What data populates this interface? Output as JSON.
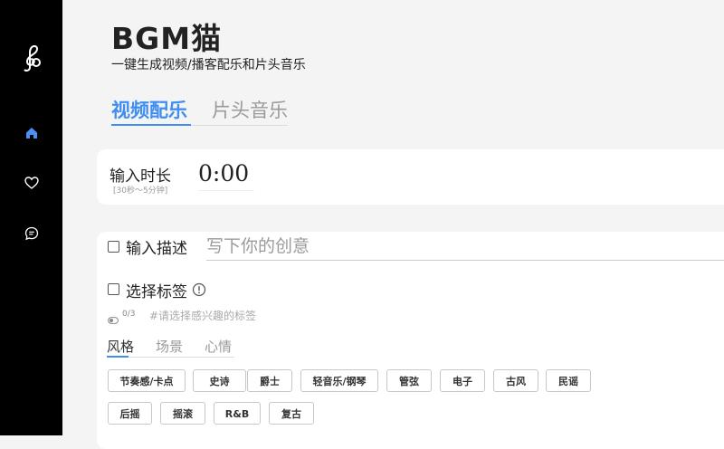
{
  "brand": {
    "title": "BGM猫",
    "subtitle": "一键生成视频/播客配乐和片头音乐"
  },
  "main_tabs": [
    {
      "label": "视频配乐",
      "active": true
    },
    {
      "label": "片头音乐",
      "active": false
    }
  ],
  "duration": {
    "label": "输入时长",
    "hint": "[30秒～5分钟]",
    "value": "0:00"
  },
  "description": {
    "label": "输入描述",
    "placeholder": "写下你的创意",
    "checked": false
  },
  "tags": {
    "label": "选择标签",
    "count": "0/3",
    "hint": "#请选择感兴趣的标签",
    "checked": false,
    "subtabs": [
      {
        "label": "风格",
        "active": true
      },
      {
        "label": "场景"
      },
      {
        "label": "心情"
      }
    ],
    "items": [
      "节奏感/卡点",
      "史诗",
      "爵士",
      "轻音乐/钢琴",
      "管弦",
      "电子",
      "古风",
      "民谣",
      "后摇",
      "摇滚",
      "R&B",
      "复古"
    ]
  },
  "sidebar": {
    "icons": [
      "home-icon",
      "heart-icon",
      "chat-icon"
    ],
    "accent": "#4c8ff5"
  },
  "colors": {
    "accent": "#3f8ef0",
    "sidebar_bg": "#000000",
    "page_bg": "#f4f4f4"
  }
}
